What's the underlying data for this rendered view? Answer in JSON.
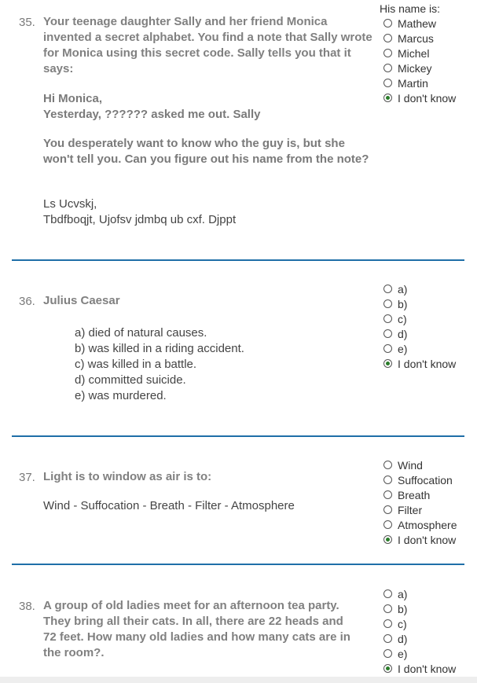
{
  "questions": [
    {
      "number": "35.",
      "text": "Your teenage daughter Sally and her friend Monica invented a secret alphabet. You find a note that Sally wrote for Monica using this secret code. Sally tells you that it says:",
      "note_lines": [
        "Hi Monica,",
        "Yesterday, ?????? asked me out. Sally"
      ],
      "paragraph": "You desperately want to know who the guy is, but she won't tell you. Can you figure out his name from the note?",
      "code_lines": [
        "Ls Ucvskj,",
        "Tbdfboqjt, Ujofsv jdmbq ub cxf. Djppt"
      ],
      "radio_title": "His name is:",
      "options": [
        {
          "label": "Mathew",
          "checked": false
        },
        {
          "label": "Marcus",
          "checked": false
        },
        {
          "label": "Michel",
          "checked": false
        },
        {
          "label": "Mickey",
          "checked": false
        },
        {
          "label": "Martin",
          "checked": false
        },
        {
          "label": "I don't know",
          "checked": true
        }
      ]
    },
    {
      "number": "36.",
      "text": "Julius Caesar",
      "choices": [
        "a) died of natural causes.",
        "b) was killed in a riding accident.",
        "c) was killed in a battle.",
        "d) committed suicide.",
        "e) was murdered."
      ],
      "options": [
        {
          "label": "a)",
          "checked": false
        },
        {
          "label": "b)",
          "checked": false
        },
        {
          "label": "c)",
          "checked": false
        },
        {
          "label": "d)",
          "checked": false
        },
        {
          "label": "e)",
          "checked": false
        },
        {
          "label": "I don't know",
          "checked": true
        }
      ]
    },
    {
      "number": "37.",
      "text": "Light is to window as air is to:",
      "line": "Wind - Suffocation - Breath - Filter - Atmosphere",
      "options": [
        {
          "label": "Wind",
          "checked": false
        },
        {
          "label": "Suffocation",
          "checked": false
        },
        {
          "label": "Breath",
          "checked": false
        },
        {
          "label": "Filter",
          "checked": false
        },
        {
          "label": "Atmosphere",
          "checked": false
        },
        {
          "label": "I don't know",
          "checked": true
        }
      ]
    },
    {
      "number": "38.",
      "text": "A group of old ladies meet for an afternoon tea party. They bring all their cats. In all, there are 22 heads and 72 feet. How many old ladies and how many cats are in the room?.",
      "options": [
        {
          "label": "a)",
          "checked": false
        },
        {
          "label": "b)",
          "checked": false
        },
        {
          "label": "c)",
          "checked": false
        },
        {
          "label": "d)",
          "checked": false
        },
        {
          "label": "e)",
          "checked": false
        },
        {
          "label": "I don't know",
          "checked": true
        }
      ]
    }
  ],
  "colors": {
    "divider": "#1f6fa8",
    "radio_checked": "#2a7d2a"
  }
}
